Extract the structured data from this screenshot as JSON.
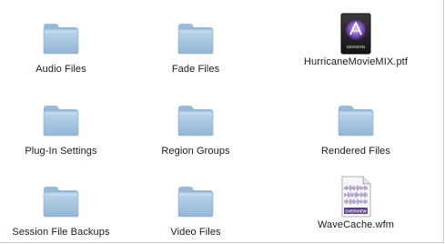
{
  "finder": {
    "items": [
      {
        "label": "Audio Files",
        "icon": "folder-icon"
      },
      {
        "label": "Fade Files",
        "icon": "folder-icon"
      },
      {
        "label": "HurricaneMovieMIX.ptf",
        "icon": "pro-tools-session-icon",
        "icon_text": "SESSION"
      },
      {
        "label": "Plug-In Settings",
        "icon": "folder-icon"
      },
      {
        "label": "Region Groups",
        "icon": "folder-icon"
      },
      {
        "label": "Rendered Files",
        "icon": "folder-icon"
      },
      {
        "label": "Session File Backups",
        "icon": "folder-icon"
      },
      {
        "label": "Video Files",
        "icon": "folder-icon"
      },
      {
        "label": "WaveCache.wfm",
        "icon": "waveform-cache-icon",
        "icon_text": "OVERVIEW"
      }
    ]
  },
  "colors": {
    "folder_front": "#a9c6df",
    "folder_back": "#8fb0cf",
    "session_icon_bg": "#2a2a2e",
    "session_accent": "#8a5cc9",
    "overview_wave": "#6a4a9a"
  }
}
